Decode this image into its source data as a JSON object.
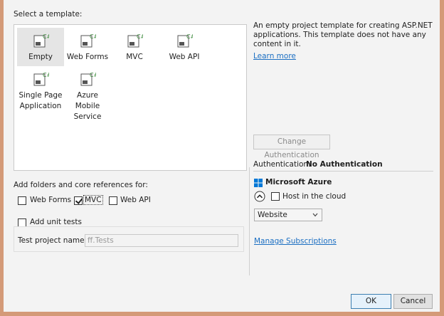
{
  "dialog": {
    "select_template_label": "Select a template:",
    "templates": [
      {
        "name": "Empty"
      },
      {
        "name": "Web Forms"
      },
      {
        "name": "MVC"
      },
      {
        "name": "Web API"
      },
      {
        "name": "Single Page Application"
      },
      {
        "name": "Azure Mobile Service"
      }
    ],
    "description": "An empty project template for creating ASP.NET applications. This template does not have any content in it.",
    "learn_more": "Learn more",
    "change_auth_button": "Change Authentication",
    "auth_label": "Authentication:",
    "auth_value": "No Authentication",
    "folders_label": "Add folders and core references for:",
    "folder_options": [
      {
        "label": "Web Forms",
        "checked": false
      },
      {
        "label": "MVC",
        "checked": true
      },
      {
        "label": "Web API",
        "checked": false
      }
    ],
    "unit_tests_label": "Add unit tests",
    "test_project_label": "Test project name:",
    "test_project_value": "ff.Tests",
    "azure_title": "Microsoft Azure",
    "host_in_cloud_label": "Host in the cloud",
    "host_type_value": "Website",
    "manage_subscriptions": "Manage Subscriptions",
    "ok_button": "OK",
    "cancel_button": "Cancel"
  },
  "icons": {
    "template": "csharp-web-project-icon",
    "azure": "windows-logo-icon",
    "expand": "chevron-up-circle-icon",
    "dropdown": "chevron-down-icon"
  },
  "colors": {
    "frame": "#d49a78",
    "dialog_bg": "#f3f3f3",
    "link": "#1a6ec2",
    "azure_blue": "#0078d7",
    "csharp_green": "#3a8a3a"
  }
}
